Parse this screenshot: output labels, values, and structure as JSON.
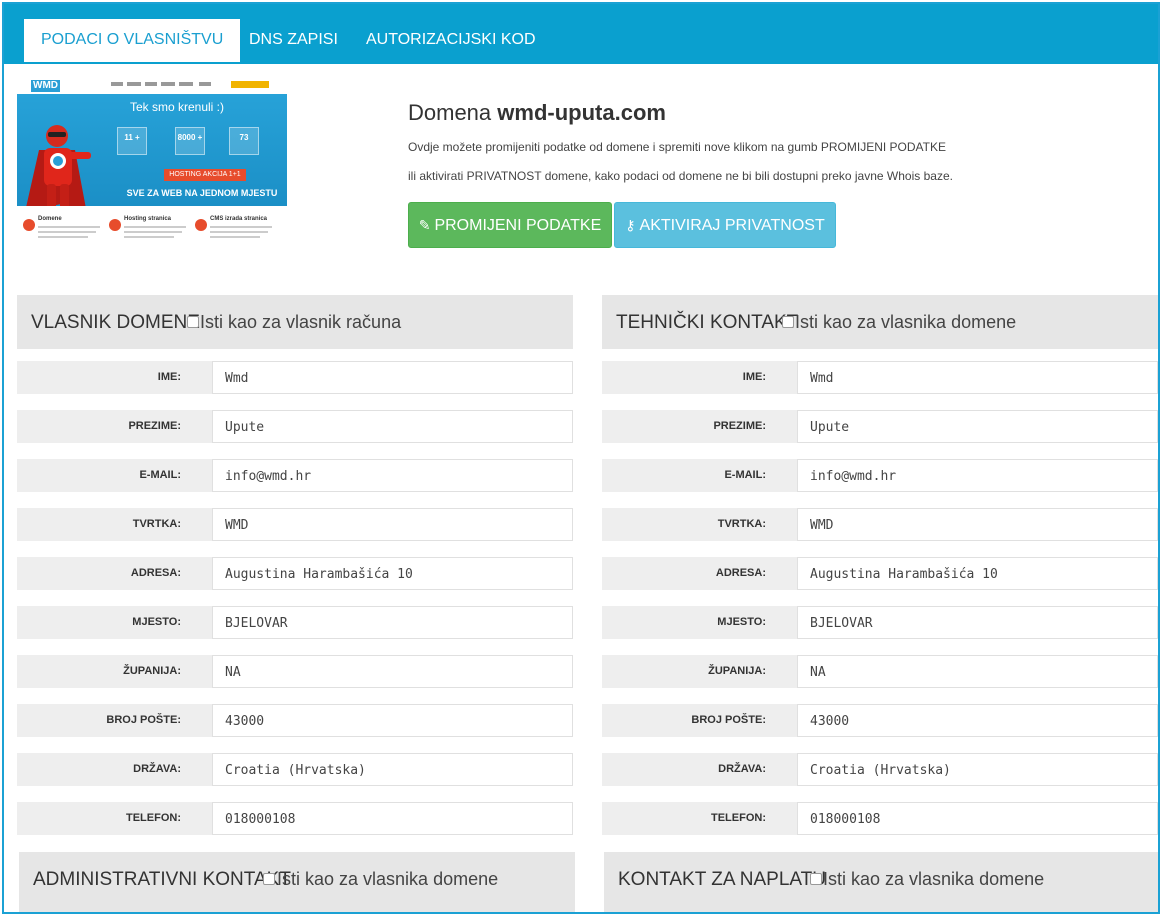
{
  "tabs": [
    {
      "label": "PODACI O VLASNIŠTVU",
      "active": true
    },
    {
      "label": "DNS ZAPISI",
      "active": false
    },
    {
      "label": "AUTORIZACIJSKI KOD",
      "active": false
    }
  ],
  "thumbnail": {
    "logo": "WMD",
    "tagline": "Tek smo krenuli :)",
    "stats": [
      "11 +",
      "8000 +",
      "73"
    ],
    "promo": "HOSTING AKCIJA 1+1",
    "slogan": "SVE ZA WEB NA JEDNOM MJESTU",
    "features": [
      "Domene",
      "Hosting stranica",
      "CMS izrada stranica"
    ]
  },
  "domain": {
    "prefix": "Domena ",
    "name": "wmd-uputa.com",
    "desc1": "Ovdje možete promijeniti podatke od domene i spremiti nove klikom na gumb PROMIJENI PODATKE",
    "desc2": "ili aktivirati PRIVATNOST domene, kako podaci od domene ne bi bili dostupni preko javne Whois baze."
  },
  "buttons": {
    "change_icon": "✎",
    "change": "PROMIJENI PODATKE",
    "privacy_icon": "⚷",
    "privacy": "AKTIVIRAJ PRIVATNOST"
  },
  "labels": {
    "ime": "IME:",
    "prezime": "PREZIME:",
    "email": "E-MAIL:",
    "tvrtka": "TVRTKA:",
    "adresa": "ADRESA:",
    "mjesto": "MJESTO:",
    "zupanija": "ŽUPANIJA:",
    "broj_poste": "BROJ POŠTE:",
    "drzava": "DRŽAVA:",
    "telefon": "TELEFON:"
  },
  "owner": {
    "title": "VLASNIK DOMENE",
    "same_as": "Isti kao za vlasnik računa",
    "ime": "Wmd",
    "prezime": "Upute",
    "email": "info@wmd.hr",
    "tvrtka": "WMD",
    "adresa": "Augustina Harambašića 10",
    "mjesto": "BJELOVAR",
    "zupanija": "NA",
    "broj_poste": "43000",
    "drzava": "Croatia (Hrvatska)",
    "telefon": "018000108"
  },
  "tech": {
    "title": "TEHNIČKI KONTAKT",
    "same_as": "Isti kao za vlasnika domene",
    "ime": "Wmd",
    "prezime": "Upute",
    "email": "info@wmd.hr",
    "tvrtka": "WMD",
    "adresa": "Augustina Harambašića 10",
    "mjesto": "BJELOVAR",
    "zupanija": "NA",
    "broj_poste": "43000",
    "drzava": "Croatia (Hrvatska)",
    "telefon": "018000108"
  },
  "admin": {
    "title": "ADMINISTRATIVNI KONTAKT",
    "same_as": "Isti kao za vlasnika domene"
  },
  "billing": {
    "title": "KONTAKT ZA NAPLATU",
    "same_as": "Isti kao za vlasnika domene"
  },
  "colors": {
    "tab_bar": "#0aa0cf",
    "btn_change": "#5cb85c",
    "btn_privacy": "#5bc0de",
    "panel_bg": "#e6e6e6"
  }
}
